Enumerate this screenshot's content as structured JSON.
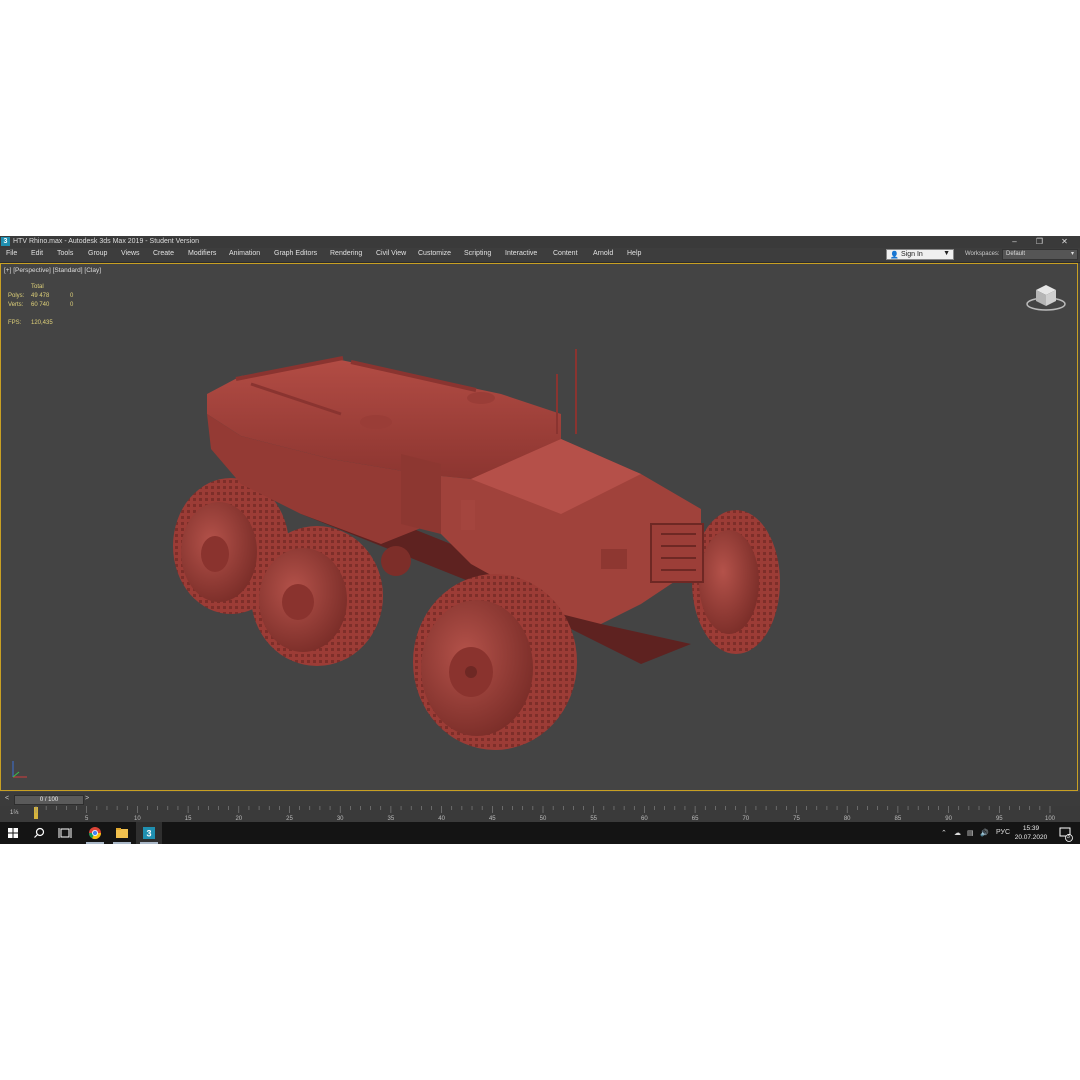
{
  "window": {
    "title": "HTV Rhino.max - Autodesk 3ds Max 2019 - Student Version",
    "app_icon_glyph": "3",
    "controls": {
      "minimize": "–",
      "maximize": "❐",
      "close": "✕"
    }
  },
  "menu": {
    "items": [
      "File",
      "Edit",
      "Tools",
      "Group",
      "Views",
      "Create",
      "Modifiers",
      "Animation",
      "Graph Editors",
      "Rendering",
      "Civil View",
      "Customize",
      "Scripting",
      "Interactive",
      "Content",
      "Arnold",
      "Help"
    ],
    "sign_in": "Sign In",
    "workspaces_label": "Workspaces:",
    "workspace_value": "Default"
  },
  "viewport": {
    "label": "[+] [Perspective] [Standard] [Clay]",
    "stats": {
      "header": "Total",
      "polys_label": "Polys:",
      "polys_value": "49 478",
      "polys_sel": "0",
      "verts_label": "Verts:",
      "verts_value": "60 740",
      "verts_sel": "0",
      "fps_label": "FPS:",
      "fps_value": "120,435"
    },
    "clay_color": "#a3413a",
    "background_color": "#444444",
    "border_color": "#c8a023"
  },
  "timeline": {
    "slider_value": "0 / 100",
    "prev_arrow": "<",
    "next_arrow": ">",
    "ticks": [
      "5",
      "10",
      "15",
      "20",
      "25",
      "30",
      "35",
      "40",
      "45",
      "50",
      "55",
      "60",
      "65",
      "70",
      "75",
      "80",
      "85",
      "90",
      "95",
      "100"
    ],
    "key_filter": "1⅔"
  },
  "taskbar": {
    "icons": [
      "windows-start-icon",
      "search-icon",
      "task-view-icon",
      "chrome-icon",
      "file-explorer-icon",
      "3ds-max-icon"
    ],
    "tray_lang": "РУС",
    "time": "15:39",
    "date": "20.07.2020",
    "notifications": "3"
  }
}
